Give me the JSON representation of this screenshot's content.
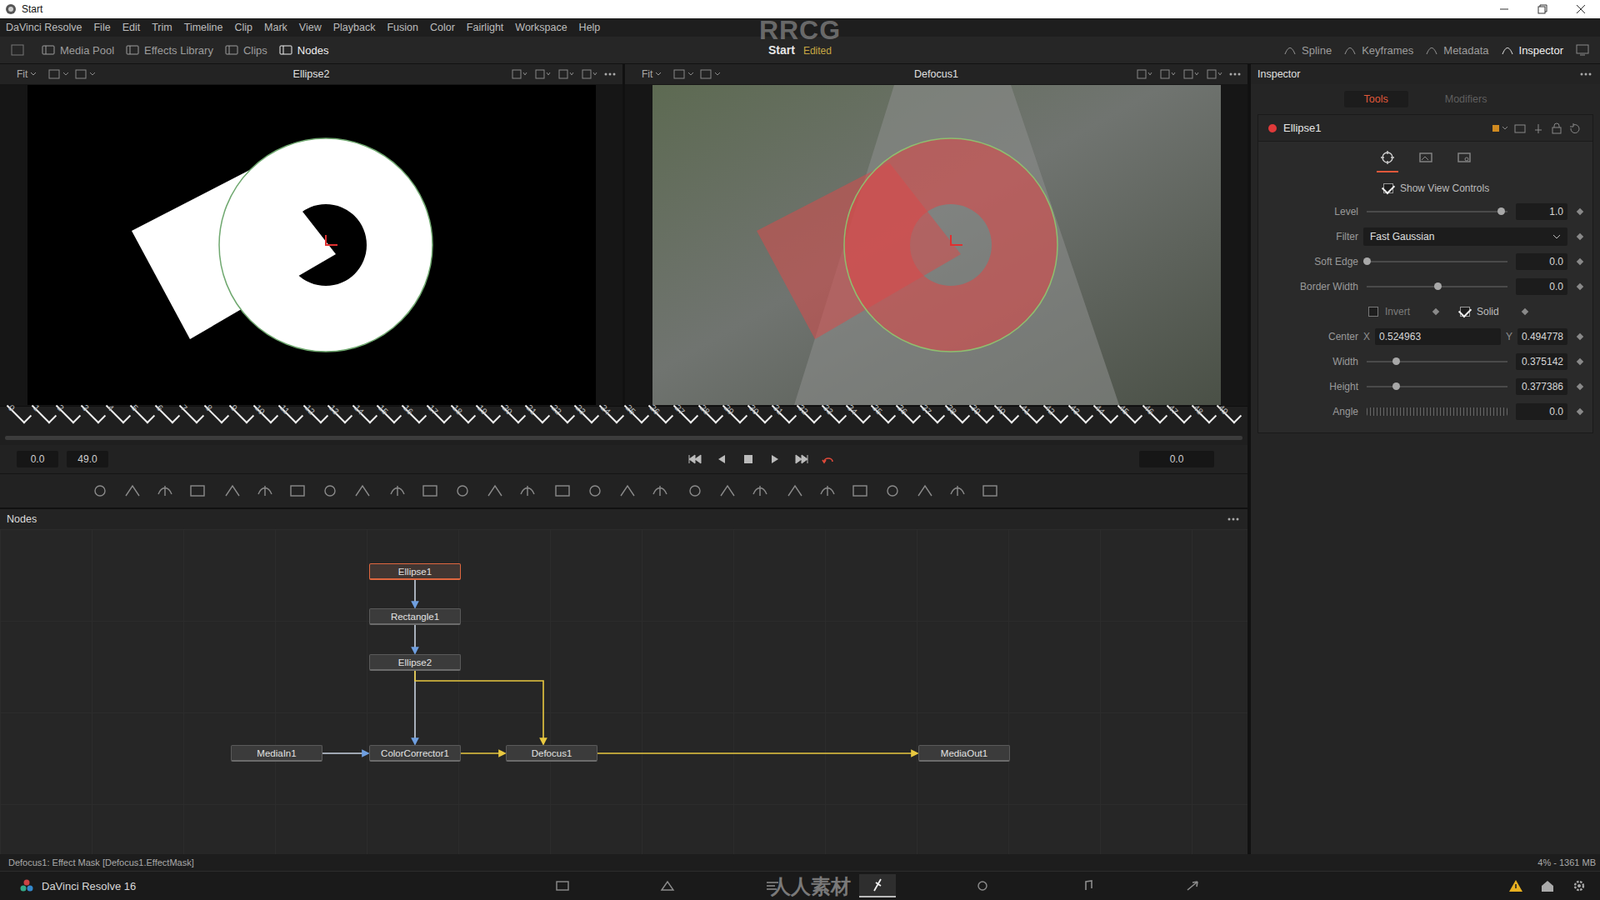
{
  "window": {
    "title": "Start"
  },
  "menu": [
    "DaVinci Resolve",
    "File",
    "Edit",
    "Trim",
    "Timeline",
    "Clip",
    "Mark",
    "View",
    "Playback",
    "Fusion",
    "Color",
    "Fairlight",
    "Workspace",
    "Help"
  ],
  "toolbar": {
    "left": [
      {
        "label": "Media Pool",
        "selected": false
      },
      {
        "label": "Effects Library",
        "selected": false
      },
      {
        "label": "Clips",
        "selected": false
      },
      {
        "label": "Nodes",
        "selected": true
      }
    ],
    "project": "Start",
    "project_state": "Edited",
    "right": [
      {
        "label": "Spline",
        "selected": false
      },
      {
        "label": "Keyframes",
        "selected": false
      },
      {
        "label": "Metadata",
        "selected": false
      },
      {
        "label": "Inspector",
        "selected": true
      }
    ]
  },
  "watermark": {
    "top": "RRCG",
    "bottom": "人人素材"
  },
  "viewers": [
    {
      "fit": "Fit",
      "title": "Ellipse2",
      "kind": "mask"
    },
    {
      "fit": "Fit",
      "title": "Defocus1",
      "kind": "video"
    }
  ],
  "timeline": {
    "ticks": [
      "0",
      "1",
      "2",
      "3",
      "4",
      "5",
      "6",
      "7",
      "8",
      "9",
      "10",
      "11",
      "12",
      "13",
      "14",
      "15",
      "16",
      "17",
      "18",
      "19",
      "20",
      "21",
      "22",
      "23",
      "24",
      "25",
      "26",
      "27",
      "28",
      "29",
      "30",
      "31",
      "32",
      "33",
      "34",
      "35",
      "36",
      "37",
      "38",
      "39",
      "40",
      "41",
      "42",
      "43",
      "44",
      "45",
      "46",
      "47",
      "48",
      "49"
    ],
    "start": "0.0",
    "end": "49.0",
    "current": "0.0"
  },
  "nodes_panel": {
    "title": "Nodes",
    "nodes": [
      {
        "label": "Ellipse1",
        "selected": true
      },
      {
        "label": "Rectangle1",
        "selected": false
      },
      {
        "label": "Ellipse2",
        "selected": false
      },
      {
        "label": "MediaIn1",
        "selected": false
      },
      {
        "label": "ColorCorrector1",
        "selected": false
      },
      {
        "label": "Defocus1",
        "selected": false
      },
      {
        "label": "MediaOut1",
        "selected": false
      }
    ],
    "edges": [
      {
        "from": "Ellipse1",
        "to": "Rectangle1",
        "highlighted": false
      },
      {
        "from": "Rectangle1",
        "to": "Ellipse2",
        "highlighted": false
      },
      {
        "from": "Ellipse2",
        "to": "ColorCorrector1",
        "highlighted": false
      },
      {
        "from": "Ellipse2",
        "to": "Defocus1",
        "highlighted": true
      },
      {
        "from": "MediaIn1",
        "to": "ColorCorrector1",
        "highlighted": false
      },
      {
        "from": "ColorCorrector1",
        "to": "Defocus1",
        "highlighted": true
      },
      {
        "from": "Defocus1",
        "to": "MediaOut1",
        "highlighted": true
      }
    ]
  },
  "status": {
    "left": "Defocus1: Effect Mask [Defocus1.EffectMask]",
    "right": "4% - 1361 MB"
  },
  "inspector": {
    "title": "Inspector",
    "tabs": [
      {
        "label": "Tools",
        "selected": true
      },
      {
        "label": "Modifiers",
        "selected": false
      }
    ],
    "tool": "Ellipse1",
    "show_view_controls": {
      "label": "Show View Controls",
      "checked": true
    },
    "params": [
      {
        "kind": "slider",
        "label": "Level",
        "value": "1.0",
        "level": 0.95
      },
      {
        "kind": "dropdown",
        "label": "Filter",
        "value": "Fast Gaussian"
      },
      {
        "kind": "slider",
        "label": "Soft Edge",
        "value": "0.0",
        "level": 0.0
      },
      {
        "kind": "slider",
        "label": "Border Width",
        "value": "0.0",
        "level": 0.5
      },
      {
        "kind": "checks",
        "items": [
          {
            "label": "Invert",
            "checked": false
          },
          {
            "label": "Solid",
            "checked": true
          }
        ]
      },
      {
        "kind": "point",
        "label": "Center",
        "x_label": "X",
        "x": "0.524963",
        "y_label": "Y",
        "y": "0.494778"
      },
      {
        "kind": "slider",
        "label": "Width",
        "value": "0.375142",
        "level": 0.21
      },
      {
        "kind": "slider",
        "label": "Height",
        "value": "0.377386",
        "level": 0.21
      },
      {
        "kind": "angle",
        "label": "Angle",
        "value": "0.0"
      }
    ]
  },
  "bottom": {
    "app": "DaVinci Resolve 16",
    "pages": [
      {
        "selected": false
      },
      {
        "selected": false
      },
      {
        "selected": false
      },
      {
        "selected": true
      },
      {
        "selected": false
      },
      {
        "selected": false
      },
      {
        "selected": false
      }
    ]
  }
}
